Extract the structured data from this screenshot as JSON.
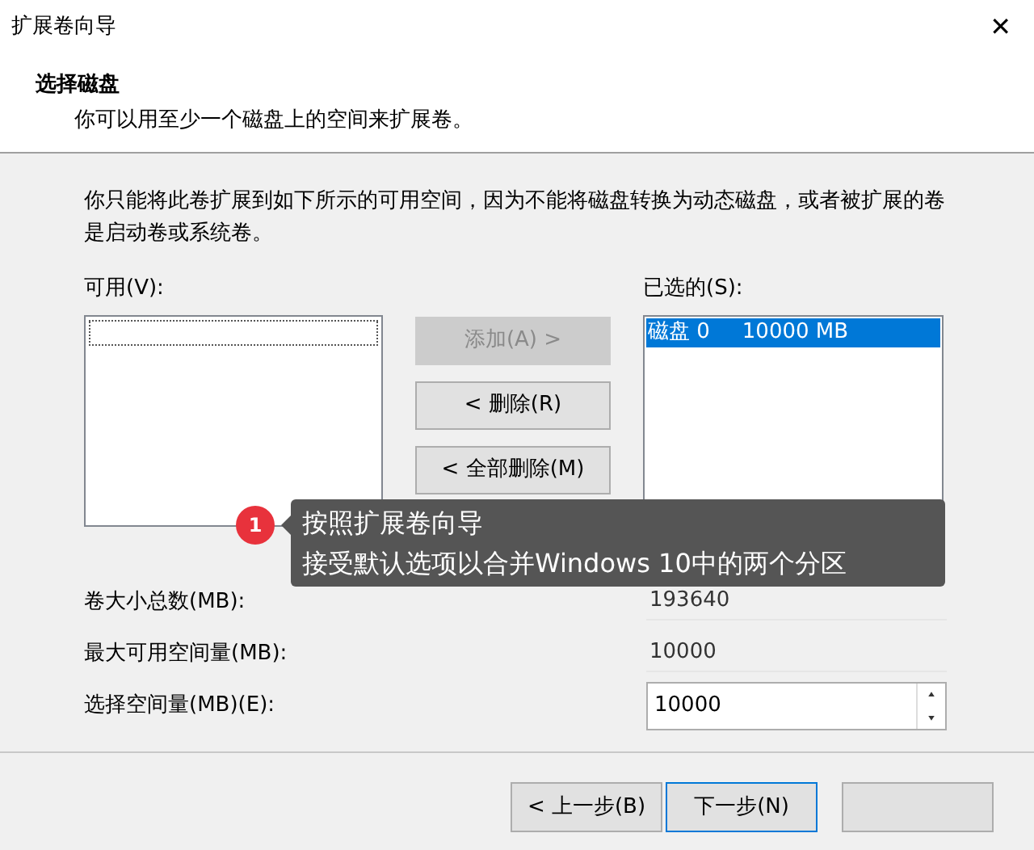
{
  "window": {
    "title": "扩展卷向导",
    "close": "✕"
  },
  "header": {
    "title": "选择磁盘",
    "subtitle": "你可以用至少一个磁盘上的空间来扩展卷。"
  },
  "description": "你只能将此卷扩展到如下所示的可用空间，因为不能将磁盘转换为动态磁盘，或者被扩展的卷是启动卷或系统卷。",
  "available": {
    "label": "可用(V):"
  },
  "selected_list": {
    "label": "已选的(S):",
    "items": [
      {
        "disk": "磁盘 0",
        "size": "10000 MB",
        "selected": true
      }
    ]
  },
  "move_buttons": [
    {
      "label": "添加(A) >",
      "disabled": true
    },
    {
      "label": "< 删除(R)",
      "disabled": false
    },
    {
      "label": "< 全部删除(M)",
      "disabled": false
    }
  ],
  "fields": [
    {
      "kind": "readonly",
      "label": "卷大小总数(MB):",
      "value": "193640"
    },
    {
      "kind": "readonly",
      "label": "最大可用空间量(MB):",
      "value": "10000"
    },
    {
      "kind": "spin",
      "label": "选择空间量(MB)(E):",
      "value": "10000"
    }
  ],
  "callout": {
    "badge": "1",
    "lines": [
      "按照扩展卷向导",
      "接受默认选项以合并Windows 10中的两个分区"
    ]
  },
  "footer_buttons": [
    {
      "label": "< 上一步(B)",
      "focused": false
    },
    {
      "label": "下一步(N)",
      "focused": true
    }
  ]
}
